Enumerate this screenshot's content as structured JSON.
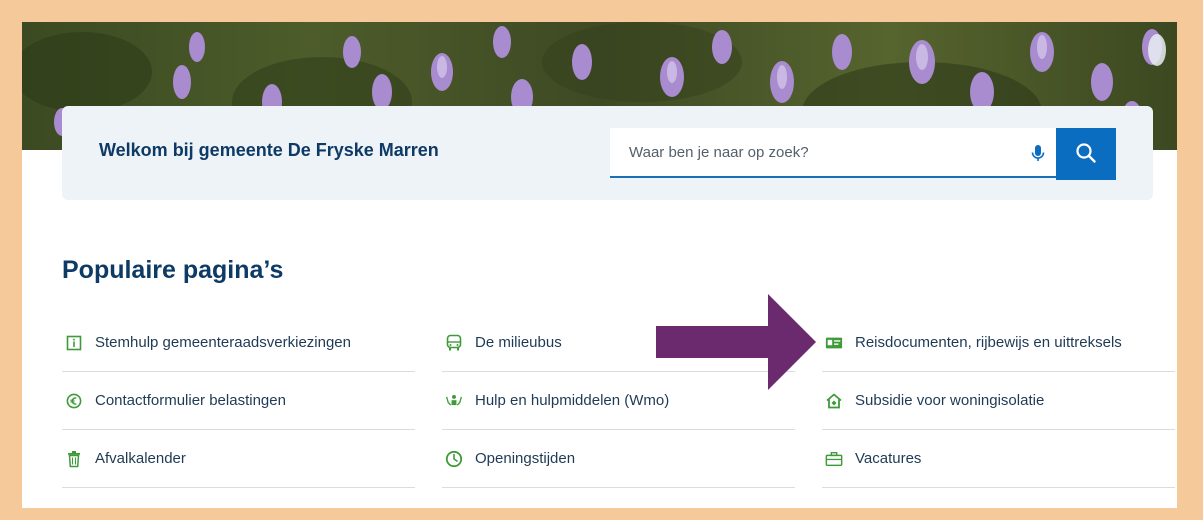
{
  "header": {
    "welcome_title": "Welkom bij gemeente De Fryske Marren"
  },
  "search": {
    "placeholder": "Waar ben je naar op zoek?",
    "mic_icon": "microphone-icon",
    "button_icon": "search-icon"
  },
  "popular": {
    "title": "Populaire pagina’s",
    "items": [
      {
        "label": "Stemhulp gemeenteraadsverkiezingen",
        "icon": "info-icon"
      },
      {
        "label": "De milieubus",
        "icon": "bus-icon"
      },
      {
        "label": "Reisdocumenten, rijbewijs en uittreksels",
        "icon": "id-card-icon"
      },
      {
        "label": "Contactformulier belastingen",
        "icon": "euro-icon"
      },
      {
        "label": "Hulp en hulpmiddelen (Wmo)",
        "icon": "care-hands-icon"
      },
      {
        "label": "Subsidie voor woningisolatie",
        "icon": "house-icon"
      },
      {
        "label": "Afvalkalender",
        "icon": "trash-icon"
      },
      {
        "label": "Openingstijden",
        "icon": "clock-icon"
      },
      {
        "label": "Vacatures",
        "icon": "briefcase-icon"
      }
    ]
  },
  "colors": {
    "brand_dark": "#0e3a66",
    "accent_blue": "#0a6dbf",
    "icon_green": "#3f9a3a",
    "arrow_purple": "#6b2a6e",
    "frame": "#f5c99a"
  }
}
